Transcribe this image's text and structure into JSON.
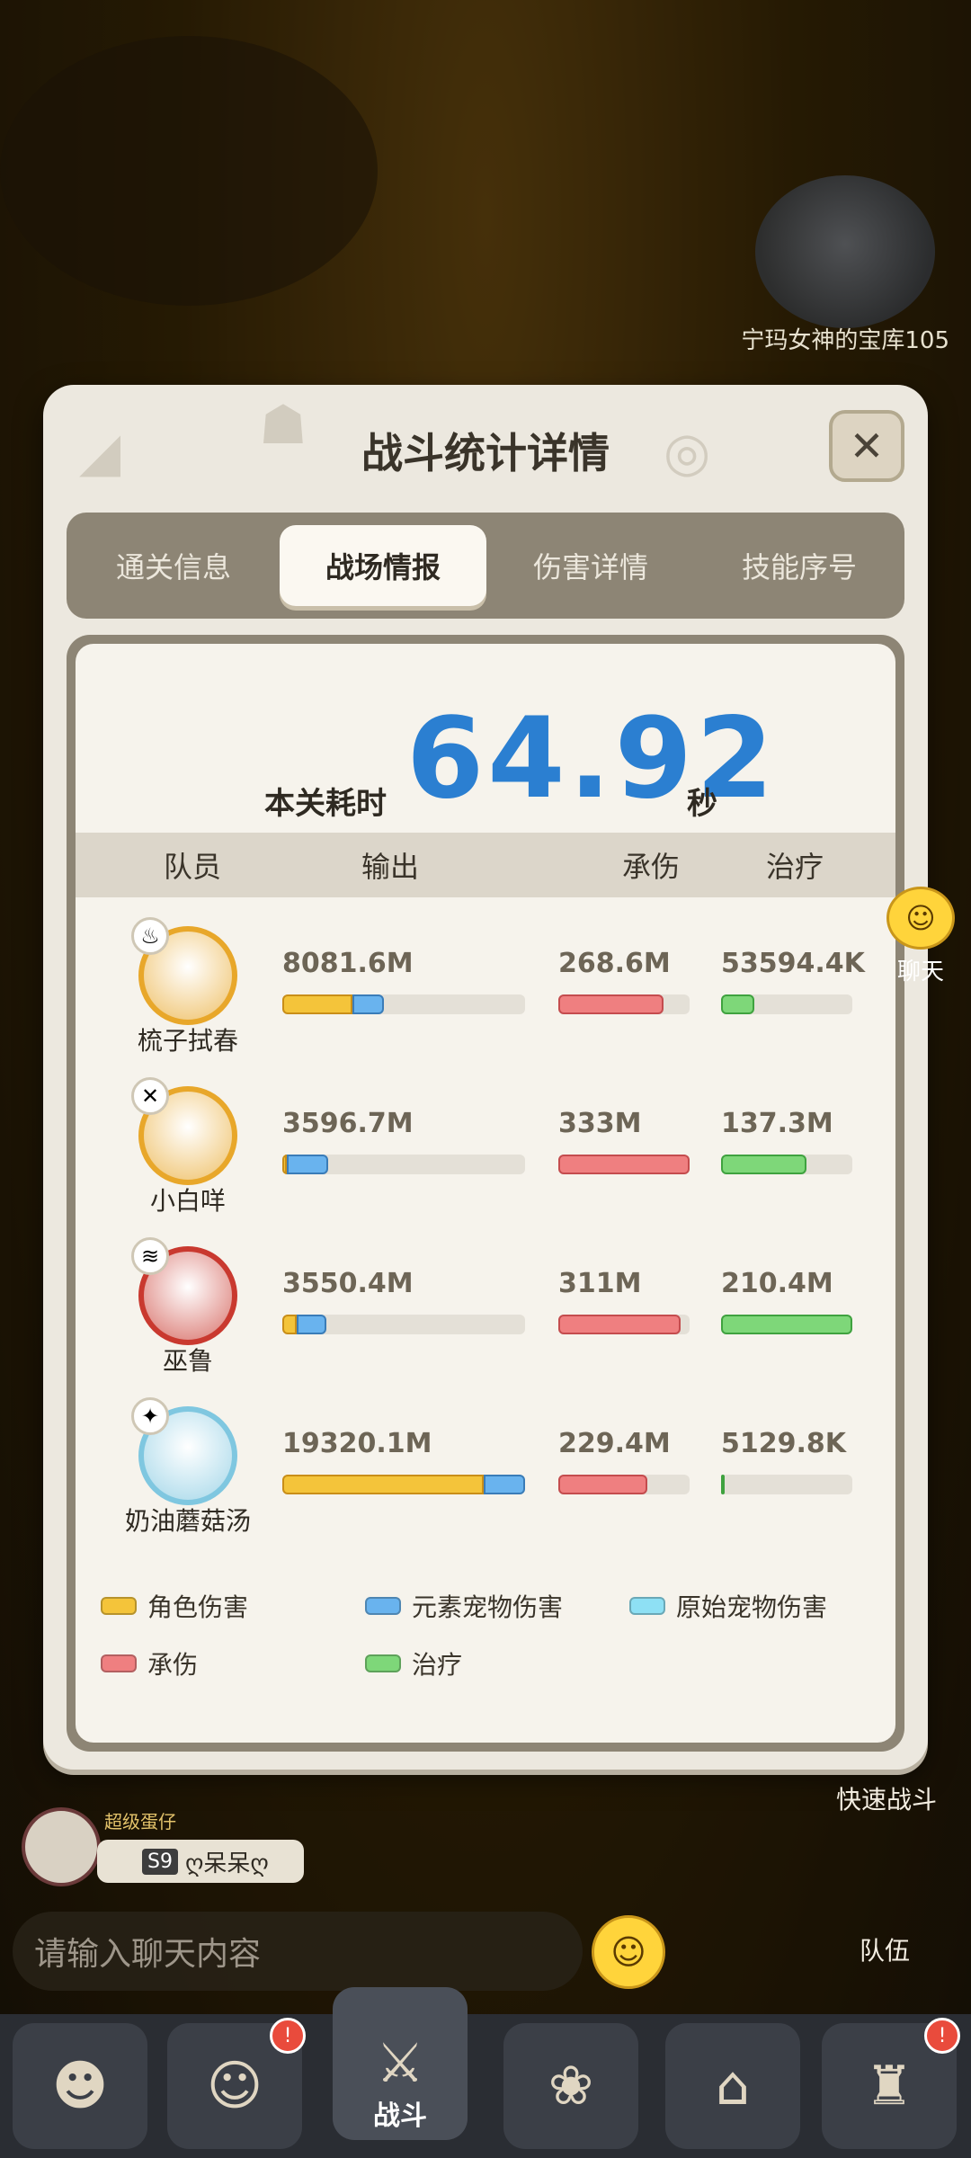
{
  "background": {
    "map_title": "宁玛女神的宝库105",
    "side_labels": {
      "quick_battle": "快速战斗",
      "team": "队伍"
    },
    "chat": {
      "label": "聊天"
    }
  },
  "modal": {
    "title": "战斗统计详情",
    "tabs": [
      "通关信息",
      "战场情报",
      "伤害详情",
      "技能序号"
    ],
    "active_tab": 1,
    "time_label": "本关耗时",
    "time_value": "64.92",
    "time_unit": "秒",
    "headers": [
      "队员",
      "输出",
      "承伤",
      "治疗"
    ],
    "members": [
      {
        "name": "梳子拭春",
        "badge_icon": "fire-element-icon",
        "ring_color": "#e8a72a",
        "output": "8081.6M",
        "taken": "268.6M",
        "healing": "53594.4K",
        "output_yellow": 0.29,
        "output_blue": 0.13,
        "taken_fill": 0.8,
        "healing_fill": 0.25
      },
      {
        "name": "小白咩",
        "badge_icon": "dark-element-icon",
        "ring_color": "#e8a72a",
        "output": "3596.7M",
        "taken": "333M",
        "healing": "137.3M",
        "output_yellow": 0.02,
        "output_blue": 0.17,
        "taken_fill": 1.0,
        "healing_fill": 0.65
      },
      {
        "name": "巫鲁",
        "badge_icon": "water-element-icon",
        "ring_color": "#c9392f",
        "output": "3550.4M",
        "taken": "311M",
        "healing": "210.4M",
        "output_yellow": 0.06,
        "output_blue": 0.12,
        "taken_fill": 0.93,
        "healing_fill": 1.0
      },
      {
        "name": "奶油蘑菇汤",
        "badge_icon": "light-element-icon",
        "ring_color": "#7fc7e0",
        "output": "19320.1M",
        "taken": "229.4M",
        "healing": "5129.8K",
        "output_yellow": 0.83,
        "output_blue": 0.17,
        "taken_fill": 0.68,
        "healing_fill": 0.03
      }
    ],
    "legend": [
      {
        "label": "角色伤害",
        "color": "#f4c43a"
      },
      {
        "label": "元素宠物伤害",
        "color": "#69b3ee"
      },
      {
        "label": "原始宠物伤害",
        "color": "#8ee0f4"
      },
      {
        "label": "承伤",
        "color": "#ef7f80"
      },
      {
        "label": "治疗",
        "color": "#7ed779"
      }
    ]
  },
  "chat_bar": {
    "placeholder": "请输入聊天内容",
    "player_tag": "超级蛋仔",
    "player_season": "S9",
    "player_name": "ღ呆呆ღ"
  },
  "bottom_nav": {
    "battle_label": "战斗"
  }
}
